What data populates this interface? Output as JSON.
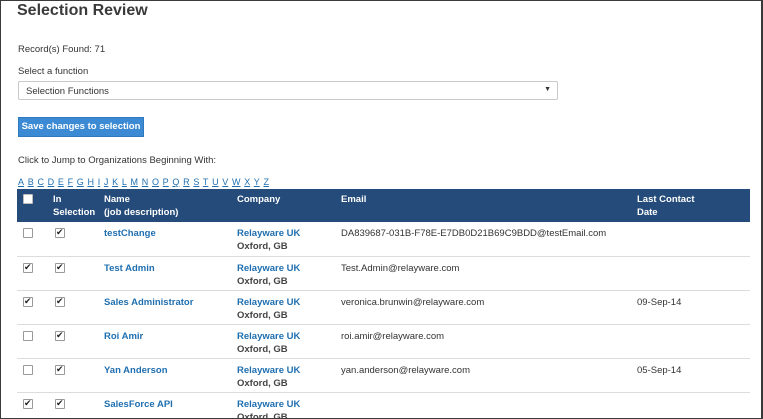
{
  "page": {
    "title": "Selection Review",
    "records_found": "Record(s) Found: 71",
    "select_label": "Select a function",
    "select_value": "Selection Functions",
    "save_button": "Save changes to selection",
    "jump_label": "Click to Jump to Organizations Beginning With:"
  },
  "alphabet": [
    "A",
    "B",
    "C",
    "D",
    "E",
    "F",
    "G",
    "H",
    "I",
    "J",
    "K",
    "L",
    "M",
    "N",
    "O",
    "P",
    "Q",
    "R",
    "S",
    "T",
    "U",
    "V",
    "W",
    "X",
    "Y",
    "Z"
  ],
  "table": {
    "headers": {
      "in_selection_1": "In",
      "in_selection_2": "Selection",
      "name_1": "Name",
      "name_2": "(job description)",
      "company": "Company",
      "email": "Email",
      "last_contact_1": "Last Contact",
      "last_contact_2": "Date"
    },
    "rows": [
      {
        "checked": false,
        "in_selection": true,
        "name": "testChange",
        "company": "Relayware UK",
        "location": "Oxford, GB",
        "email": "DA839687-031B-F78E-E7DB0D21B69C9BDD@testEmail.com",
        "date": ""
      },
      {
        "checked": true,
        "in_selection": true,
        "name": "Test Admin",
        "company": "Relayware UK",
        "location": "Oxford, GB",
        "email": "Test.Admin@relayware.com",
        "date": ""
      },
      {
        "checked": true,
        "in_selection": true,
        "name": "Sales Administrator",
        "company": "Relayware UK",
        "location": "Oxford, GB",
        "email": "veronica.brunwin@relayware.com",
        "date": "09-Sep-14"
      },
      {
        "checked": false,
        "in_selection": true,
        "name": "Roi Amir",
        "company": "Relayware UK",
        "location": "Oxford, GB",
        "email": "roi.amir@relayware.com",
        "date": ""
      },
      {
        "checked": false,
        "in_selection": true,
        "name": "Yan Anderson",
        "company": "Relayware UK",
        "location": "Oxford, GB",
        "email": "yan.anderson@relayware.com",
        "date": "05-Sep-14"
      },
      {
        "checked": true,
        "in_selection": true,
        "name": "SalesForce API",
        "company": "Relayware UK",
        "location": "Oxford, GB",
        "email": "",
        "date": ""
      }
    ]
  }
}
